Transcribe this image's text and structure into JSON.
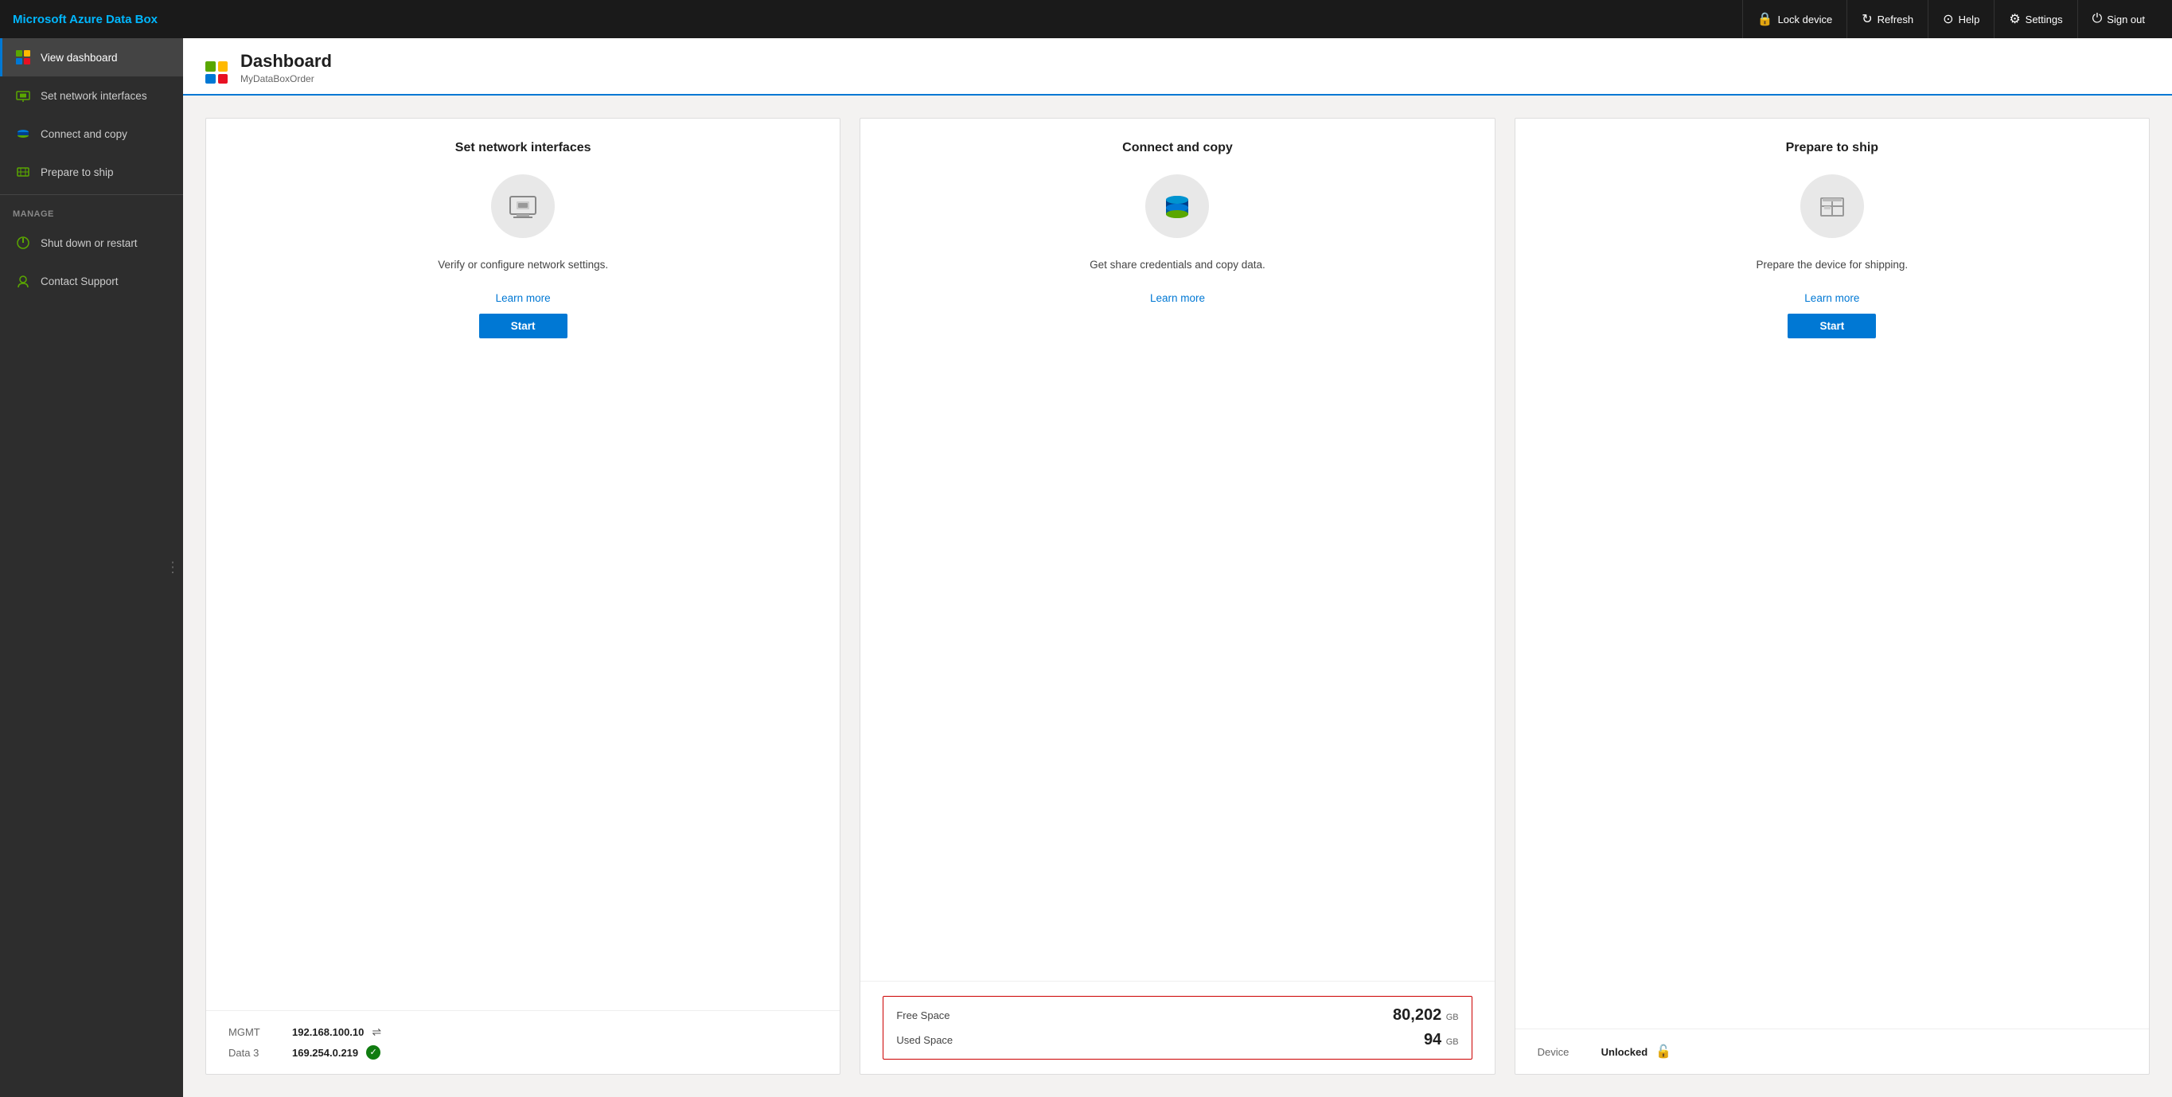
{
  "app": {
    "title": "Microsoft Azure Data Box"
  },
  "topbar": {
    "buttons": [
      {
        "id": "lock-device",
        "label": "Lock device",
        "icon": "🔒"
      },
      {
        "id": "refresh",
        "label": "Refresh",
        "icon": "↻"
      },
      {
        "id": "help",
        "label": "Help",
        "icon": "?"
      },
      {
        "id": "settings",
        "label": "Settings",
        "icon": "⚙"
      },
      {
        "id": "sign-out",
        "label": "Sign out",
        "icon": "⏻"
      }
    ]
  },
  "sidebar": {
    "nav_items": [
      {
        "id": "view-dashboard",
        "label": "View dashboard",
        "active": true
      },
      {
        "id": "set-network-interfaces",
        "label": "Set network interfaces"
      },
      {
        "id": "connect-and-copy",
        "label": "Connect and copy"
      },
      {
        "id": "prepare-to-ship",
        "label": "Prepare to ship"
      }
    ],
    "manage_label": "MANAGE",
    "manage_items": [
      {
        "id": "shut-down-restart",
        "label": "Shut down or restart"
      },
      {
        "id": "contact-support",
        "label": "Contact Support"
      }
    ]
  },
  "page": {
    "title": "Dashboard",
    "subtitle": "MyDataBoxOrder"
  },
  "cards": [
    {
      "id": "set-network-interfaces",
      "title": "Set network interfaces",
      "description": "Verify or configure network settings.",
      "learn_more_label": "Learn more",
      "start_label": "Start",
      "footer": [
        {
          "label": "MGMT",
          "value": "192.168.100.10",
          "extra": "⇌",
          "extra_type": "link-icon"
        },
        {
          "label": "Data 3",
          "value": "169.254.0.219",
          "extra": "✓",
          "extra_type": "check"
        }
      ]
    },
    {
      "id": "connect-and-copy",
      "title": "Connect and copy",
      "description": "Get share credentials and copy data.",
      "learn_more_label": "Learn more",
      "start_label": null,
      "space": {
        "free_space_label": "Free Space",
        "free_space_value": "80,202",
        "free_space_unit": "GB",
        "used_space_label": "Used Space",
        "used_space_value": "94",
        "used_space_unit": "GB"
      }
    },
    {
      "id": "prepare-to-ship",
      "title": "Prepare to ship",
      "description": "Prepare the device for shipping.",
      "learn_more_label": "Learn more",
      "start_label": "Start",
      "footer": [
        {
          "label": "Device",
          "value": "Unlocked",
          "extra": "🔓",
          "extra_type": "lock-icon"
        }
      ]
    }
  ]
}
